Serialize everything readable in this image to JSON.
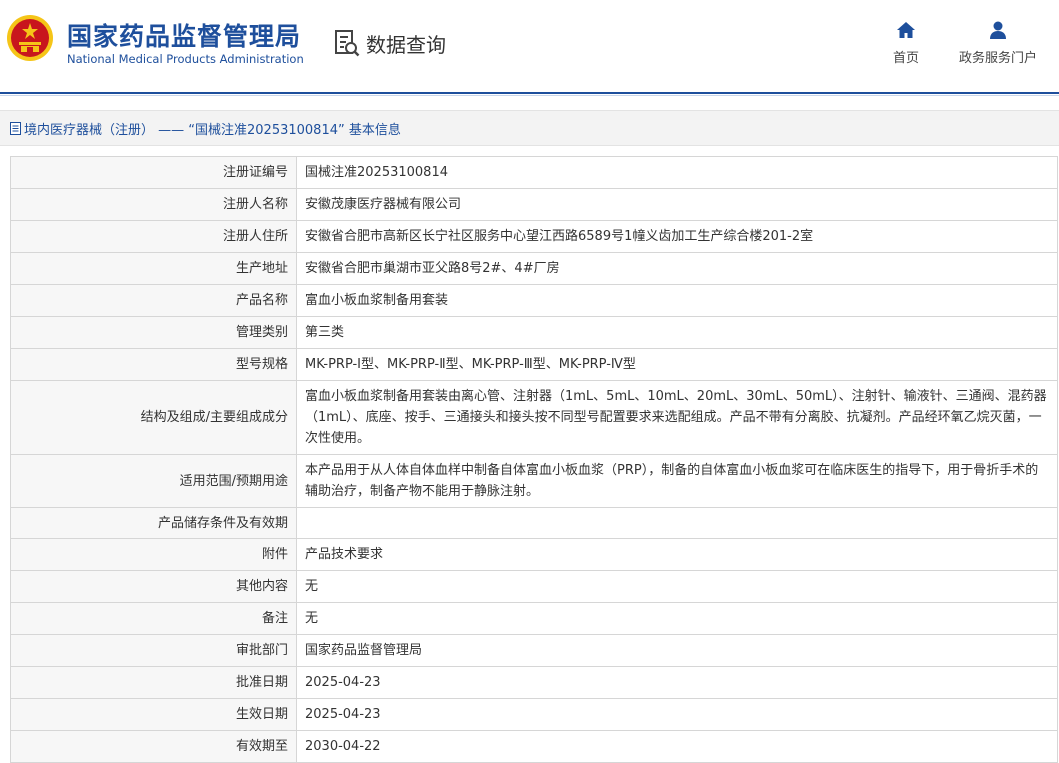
{
  "header": {
    "org_cn": "国家药品监督管理局",
    "org_en": "National Medical Products Administration",
    "query_label": "数据查询",
    "nav": [
      {
        "label": "首页",
        "icon": "home-icon"
      },
      {
        "label": "政务服务门户",
        "icon": "user-icon"
      }
    ]
  },
  "breadcrumb": {
    "text": "境内医疗器械（注册） —— “国械注准20253100814” 基本信息",
    "icon": "document-icon"
  },
  "colors": {
    "brand": "#1e4f9c",
    "emblem_red": "#c8161d",
    "emblem_gold": "#f5c518"
  },
  "rows": [
    {
      "key": "注册证编号",
      "value": "国械注准20253100814"
    },
    {
      "key": "注册人名称",
      "value": "安徽茂康医疗器械有限公司"
    },
    {
      "key": "注册人住所",
      "value": "安徽省合肥市高新区长宁社区服务中心望江西路6589号1幢义齿加工生产综合楼201-2室"
    },
    {
      "key": "生产地址",
      "value": "安徽省合肥市巢湖市亚父路8号2#、4#厂房"
    },
    {
      "key": "产品名称",
      "value": "富血小板血浆制备用套装"
    },
    {
      "key": "管理类别",
      "value": "第三类"
    },
    {
      "key": "型号规格",
      "value": "MK-PRP-Ⅰ型、MK-PRP-Ⅱ型、MK-PRP-Ⅲ型、MK-PRP-Ⅳ型"
    },
    {
      "key": "结构及组成/主要组成成分",
      "value": "富血小板血浆制备用套装由离心管、注射器（1mL、5mL、10mL、20mL、30mL、50mL）、注射针、输液针、三通阀、混药器（1mL）、底座、按手、三通接头和接头按不同型号配置要求来选配组成。产品不带有分离胶、抗凝剂。产品经环氧乙烷灭菌，一次性使用。"
    },
    {
      "key": "适用范围/预期用途",
      "value": "本产品用于从人体自体血样中制备自体富血小板血浆（PRP），制备的自体富血小板血浆可在临床医生的指导下，用于骨折手术的辅助治疗，制备产物不能用于静脉注射。"
    },
    {
      "key": "产品储存条件及有效期",
      "value": ""
    },
    {
      "key": "附件",
      "value": "产品技术要求"
    },
    {
      "key": "其他内容",
      "value": "无"
    },
    {
      "key": "备注",
      "value": "无"
    },
    {
      "key": "审批部门",
      "value": "国家药品监督管理局"
    },
    {
      "key": "批准日期",
      "value": "2025-04-23"
    },
    {
      "key": "生效日期",
      "value": "2025-04-23"
    },
    {
      "key": "有效期至",
      "value": "2030-04-22"
    }
  ]
}
